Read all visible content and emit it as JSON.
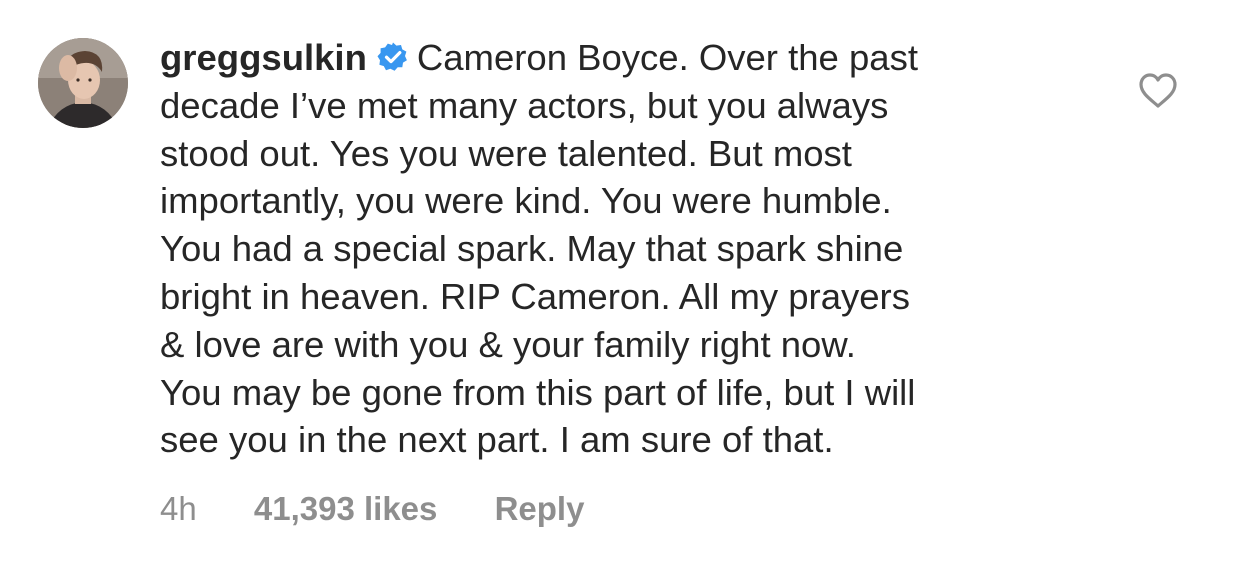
{
  "comment": {
    "username": "greggsulkin",
    "verified": true,
    "text_lines": [
      "Cameron Boyce. Over the past",
      "decade I’ve met many actors, but you always",
      "stood out. Yes you were talented. But most",
      "importantly, you were kind. You were humble.",
      "You had a special spark. May that spark shine",
      "bright in heaven. RIP Cameron. All my prayers",
      "& love are with you & your family right now.",
      "You may be gone from this part of life, but I will",
      "see you in the next part. I am sure of that."
    ],
    "time": "4h",
    "likes": "41,393 likes",
    "reply_label": "Reply",
    "avatar_icon": "profile-photo",
    "like_icon": "heart-outline-icon",
    "verified_icon": "verified-badge-icon"
  },
  "colors": {
    "text": "#262626",
    "meta": "#8e8e8e",
    "verified_badge": "#3897f0",
    "heart_outline": "#8e8e8e"
  }
}
